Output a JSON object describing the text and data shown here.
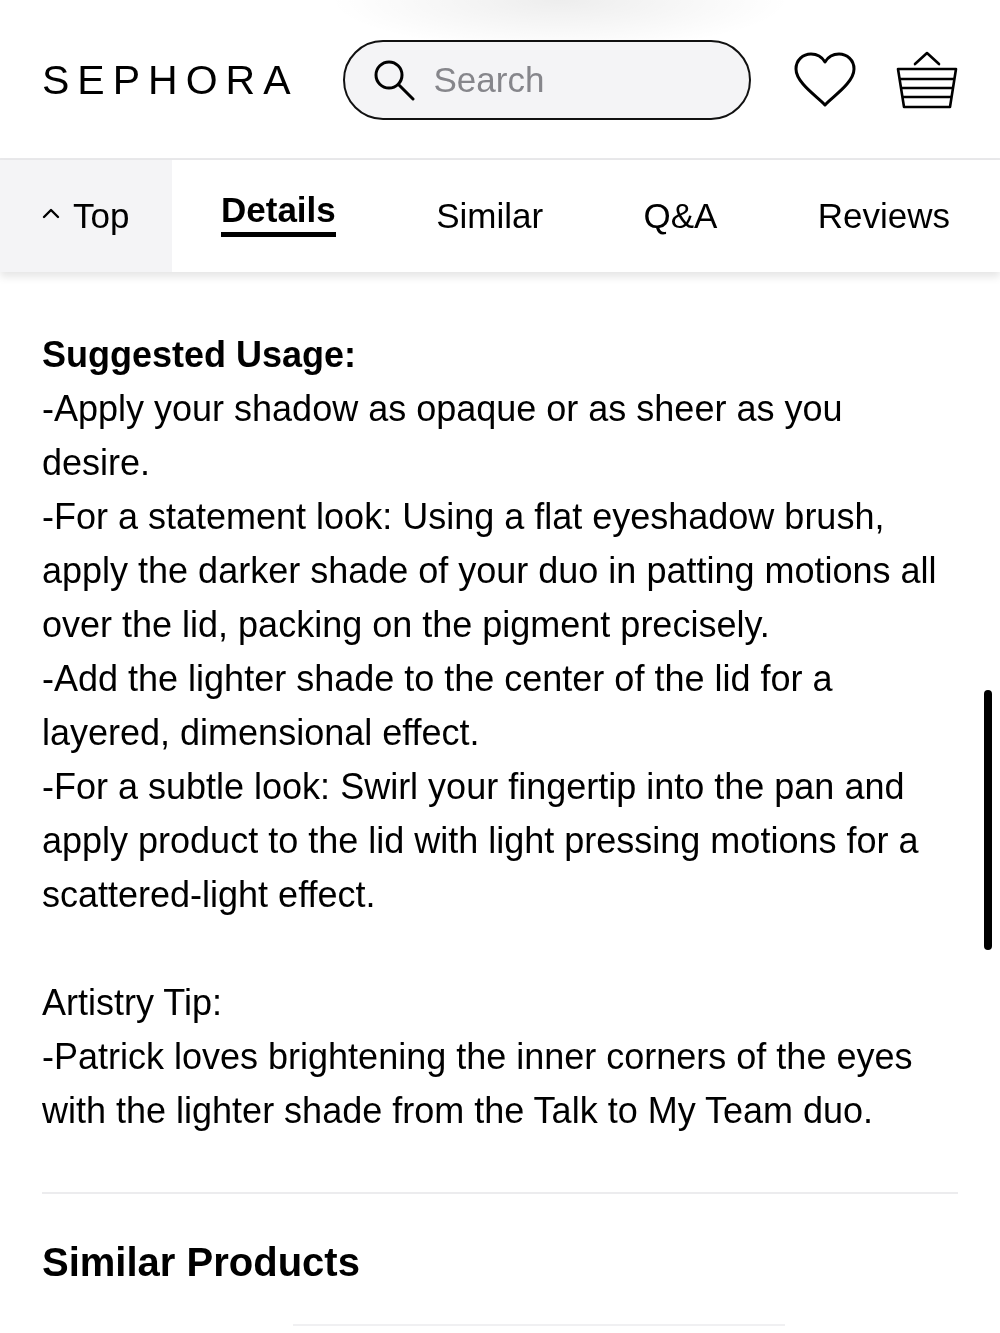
{
  "header": {
    "logo": "SEPHORA",
    "search": {
      "placeholder": "Search"
    }
  },
  "tab_bar": {
    "top_button": {
      "label": "Top"
    },
    "tabs": [
      {
        "label": "Details",
        "selected": true
      },
      {
        "label": "Similar",
        "selected": false
      },
      {
        "label": "Q&A",
        "selected": false
      },
      {
        "label": "Reviews",
        "selected": false
      }
    ]
  },
  "details": {
    "sections": [
      {
        "kind": "heading",
        "title": "Suggested Usage:",
        "lines": [
          "-Apply your shadow as opaque or as sheer as you desire.",
          "-For a statement look: Using a flat eyeshadow brush, apply the darker shade of your duo in patting motions all over the lid, packing on the pigment precisely.",
          "-Add the lighter shade to the center of the lid for a layered, dimensional effect.",
          "-For a subtle look: Swirl your fingertip into the pan and apply product to the lid with light pressing motions for a scattered-light effect."
        ]
      },
      {
        "kind": "label",
        "title": "Artistry Tip:",
        "lines": [
          "-Patrick loves brightening the inner corners of the eyes with the lighter shade from the Talk to My Team duo."
        ]
      }
    ]
  },
  "similar_products": {
    "title": "Similar Products"
  }
}
